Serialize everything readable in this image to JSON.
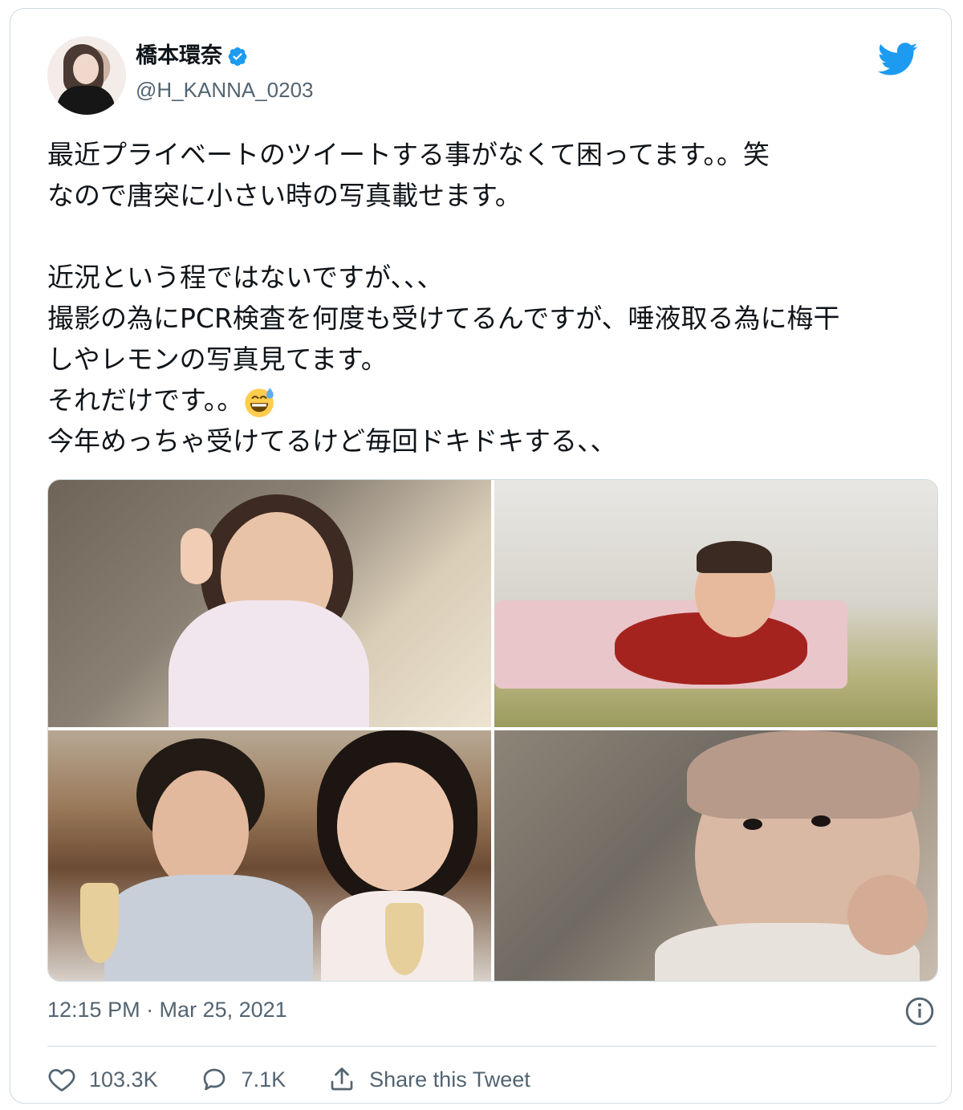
{
  "user": {
    "display_name": "橋本環奈",
    "handle": "@H_KANNA_0203",
    "verified": true
  },
  "brand": {
    "icon": "twitter-bird-icon",
    "color": "#1d9bf0"
  },
  "tweet": {
    "text_before_emoji": "最近プライベートのツイートする事がなくて困ってます。。笑\nなので唐突に小さい時の写真載せます。\n\n近況という程ではないですが、、、\n撮影の為にPCR検査を何度も受けてるんですが、唾液取る為に梅干\nしやレモンの写真見てます。\nそれだけです。。",
    "emoji": "grinning-face-with-sweat-icon",
    "text_after_emoji": "\n今年めっちゃ受けてるけど毎回ドキドキする、、",
    "timestamp": "12:15 PM · Mar 25, 2021"
  },
  "media": {
    "count": 4,
    "photos": [
      "photo-child-peace-sign",
      "photo-baby-on-mat",
      "photo-kids-ice-cream",
      "photo-newborn-baby"
    ]
  },
  "actions": {
    "likes": "103.3K",
    "replies": "7.1K",
    "share_label": "Share this Tweet"
  },
  "colors": {
    "text": "#0f1419",
    "secondary": "#536471",
    "border": "#cfd9de",
    "accent": "#1d9bf0"
  }
}
